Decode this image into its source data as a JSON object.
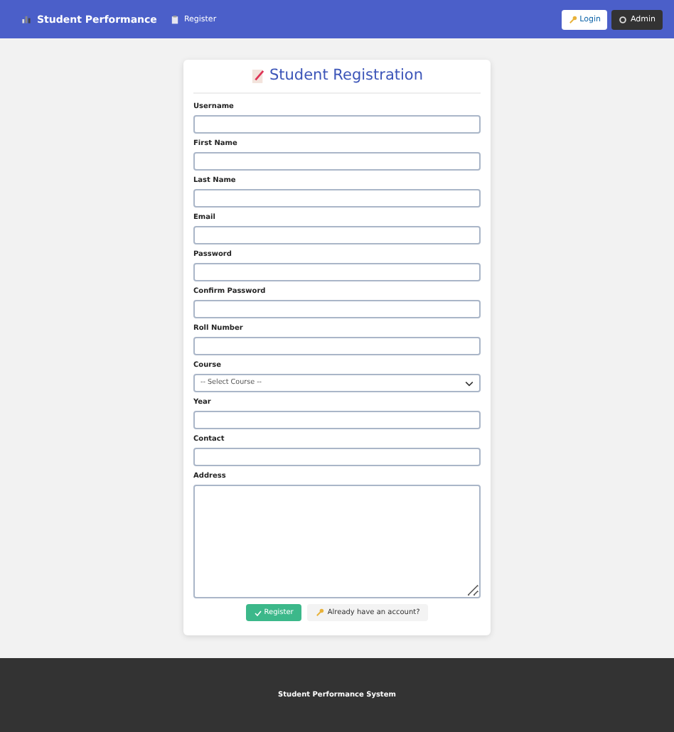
{
  "navbar": {
    "brand": "Student Performance",
    "links": [
      {
        "label": "Register"
      }
    ],
    "buttons": [
      {
        "label": "Login",
        "kind": "light"
      },
      {
        "label": "Admin",
        "kind": "dark"
      }
    ]
  },
  "form": {
    "title": "Student Registration",
    "fields": [
      {
        "label": "Username",
        "kind": "input"
      },
      {
        "label": "First Name",
        "kind": "input"
      },
      {
        "label": "Last Name",
        "kind": "input"
      },
      {
        "label": "Email",
        "kind": "input"
      },
      {
        "label": "Password",
        "kind": "input"
      },
      {
        "label": "Confirm Password",
        "kind": "input"
      },
      {
        "label": "Roll Number",
        "kind": "input"
      },
      {
        "label": "Course",
        "kind": "select",
        "value": "-- Select Course --"
      },
      {
        "label": "Year",
        "kind": "input"
      },
      {
        "label": "Contact",
        "kind": "input"
      },
      {
        "label": "Address",
        "kind": "textarea"
      }
    ],
    "submit": "Register",
    "login_link": "Already have an account?"
  },
  "footer": {
    "text": "Student Performance System"
  }
}
